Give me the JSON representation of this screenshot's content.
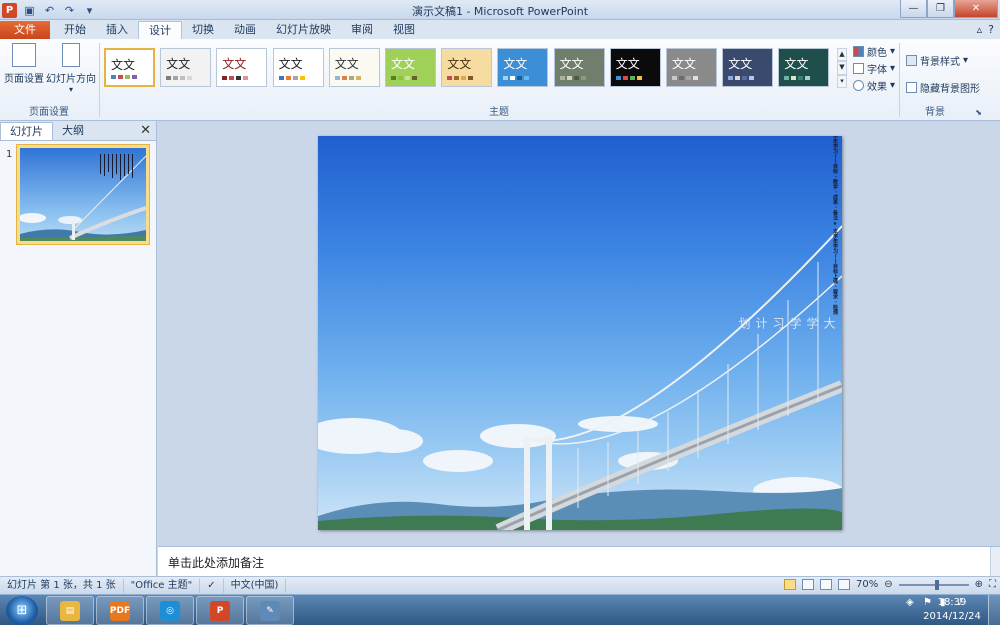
{
  "window": {
    "title": "演示文稿1 - Microsoft PowerPoint"
  },
  "tabs": [
    {
      "label": "文件"
    },
    {
      "label": "开始"
    },
    {
      "label": "插入"
    },
    {
      "label": "设计"
    },
    {
      "label": "切换"
    },
    {
      "label": "动画"
    },
    {
      "label": "幻灯片放映"
    },
    {
      "label": "审阅"
    },
    {
      "label": "视图"
    }
  ],
  "ribbon": {
    "page_setup": {
      "btn1": "页面设置",
      "btn2": "幻灯片方向",
      "group_label": "页面设置"
    },
    "themes": {
      "group_label": "主题",
      "items": [
        {
          "label": "文文",
          "bg": "#ffffff",
          "fg": "#222222",
          "sw": [
            "#4f81bd",
            "#c0504d",
            "#9bbb59",
            "#8064a2"
          ]
        },
        {
          "label": "文文",
          "bg": "#f2f2f2",
          "fg": "#222222",
          "sw": [
            "#7f7f7f",
            "#a5a5a5",
            "#bfbfbf",
            "#d8d8d8"
          ]
        },
        {
          "label": "文文",
          "bg": "#ffffff",
          "fg": "#8b1e1e",
          "sw": [
            "#8b1e1e",
            "#c0504d",
            "#333333",
            "#d99694"
          ]
        },
        {
          "label": "文文",
          "bg": "#ffffff",
          "fg": "#222222",
          "sw": [
            "#4472c4",
            "#ed7d31",
            "#a5a5a5",
            "#ffc000"
          ]
        },
        {
          "label": "文文",
          "bg": "#fbfaf2",
          "fg": "#333333",
          "sw": [
            "#94b6d2",
            "#dd8047",
            "#a5ab81",
            "#d8b25c"
          ]
        },
        {
          "label": "文文",
          "bg": "#9fd058",
          "fg": "#ffffff",
          "sw": [
            "#5a7b2b",
            "#8fc04c",
            "#c5e29a",
            "#6b5d2e"
          ]
        },
        {
          "label": "文文",
          "bg": "#f6dca0",
          "fg": "#4a2f10",
          "sw": [
            "#c0504d",
            "#9b6b2a",
            "#e0a84a",
            "#7a5a2a"
          ]
        },
        {
          "label": "文文",
          "bg": "#3c8fd6",
          "fg": "#ffffff",
          "sw": [
            "#9bd1f5",
            "#ffffff",
            "#1b5ea0",
            "#6ab6ea"
          ]
        },
        {
          "label": "文文",
          "bg": "#6f7f6c",
          "fg": "#ffffff",
          "sw": [
            "#a9b59a",
            "#d9d1b0",
            "#4e5b4b",
            "#8c9a7a"
          ]
        },
        {
          "label": "文文",
          "bg": "#0b0b0b",
          "fg": "#ffffff",
          "sw": [
            "#3b8fe0",
            "#e04b3b",
            "#59b35a",
            "#f2c23b"
          ]
        },
        {
          "label": "文文",
          "bg": "#8a8a8a",
          "fg": "#ffffff",
          "sw": [
            "#c8c8c8",
            "#6b6b6b",
            "#a5a5a5",
            "#e0e0e0"
          ]
        },
        {
          "label": "文文",
          "bg": "#3a4a6e",
          "fg": "#ffffff",
          "sw": [
            "#8faad8",
            "#d9d9d9",
            "#5a6e9c",
            "#b6c6e8"
          ]
        },
        {
          "label": "文文",
          "bg": "#1f4f4a",
          "fg": "#ffffff",
          "sw": [
            "#6fb2a6",
            "#d8e6c4",
            "#3e7f74",
            "#a6cfc4"
          ]
        }
      ],
      "colors_label": "颜色",
      "fonts_label": "字体",
      "effects_label": "效果"
    },
    "background": {
      "group_label": "背景",
      "styles_label": "背景样式",
      "hide_graphics_label": "隐藏背景图形"
    }
  },
  "left_pane": {
    "tab_slides": "幻灯片",
    "tab_outline": "大纲",
    "close": "✕",
    "thumb_number": "1"
  },
  "slide": {
    "title": "大学学习计划",
    "lines": [
      {
        "text": "★ 本学年学习——目标上课 · 要求 · 检测",
        "bold": true
      },
      {
        "text": "★ 第学年学习——目标 · 教学 · 成果 · 备注",
        "bold": true
      },
      {
        "text": "2014学年第一学期：英语、高数、政治、体育",
        "bold": false
      },
      {
        "text": "2014学年第二学期：英语、高数、计算机",
        "bold": false
      },
      {
        "text": "2015学年第一学期：专业课、选修、实践",
        "bold": false
      },
      {
        "text": "2015学年第二学期：专业课、实习",
        "bold": false
      },
      {
        "text": "学期安排：英语、数学、专业 · 实践计划",
        "bold": false
      },
      {
        "text": "★ 四年学习——目标 · 规划 · 总结 · 评估",
        "bold": true
      },
      {
        "text": "2016学年——目标 · 2010 · 00 · 00",
        "bold": false
      },
      {
        "text": "2016学年——专业课实践 2010",
        "bold": false
      },
      {
        "text": "2017学年——考研准备 2011",
        "bold": false
      },
      {
        "text": "2017学年——毕业设计 2012",
        "bold": false
      },
      {
        "text": "2018学年——实习 2013",
        "bold": false
      },
      {
        "text": "2018学年——求职规划 2014",
        "bold": false
      },
      {
        "text": "2018学年——总结 2015",
        "bold": false
      },
      {
        "text": "2019学年——毕业 2016",
        "bold": false
      },
      {
        "text": "2019学年——求职 2017",
        "bold": false
      },
      {
        "text": "★ 课外学习——读书 · 运动 · 社团",
        "bold": true
      },
      {
        "text": "★ 大四——求职 · 考研 · 出国 · 公务员考试",
        "bold": true
      }
    ]
  },
  "notes": {
    "placeholder": "单击此处添加备注"
  },
  "status": {
    "slide_info": "幻灯片 第 1 张，共 1 张",
    "theme": "\"Office 主题\"",
    "language": "中文(中国)",
    "zoom": "70%",
    "zoom_fraction": 0.55
  },
  "taskbar": {
    "time": "18:39",
    "date": "2014/12/24",
    "apps": [
      {
        "name": "explorer",
        "color": "#e9b640",
        "glyph": "▤"
      },
      {
        "name": "pdf",
        "color": "#e8771e",
        "glyph": "PDF"
      },
      {
        "name": "browser",
        "color": "#1e8fd6",
        "glyph": "◎"
      },
      {
        "name": "powerpoint",
        "color": "#d24726",
        "glyph": "P"
      },
      {
        "name": "paint",
        "color": "#5f8ab8",
        "glyph": "✎"
      }
    ]
  }
}
